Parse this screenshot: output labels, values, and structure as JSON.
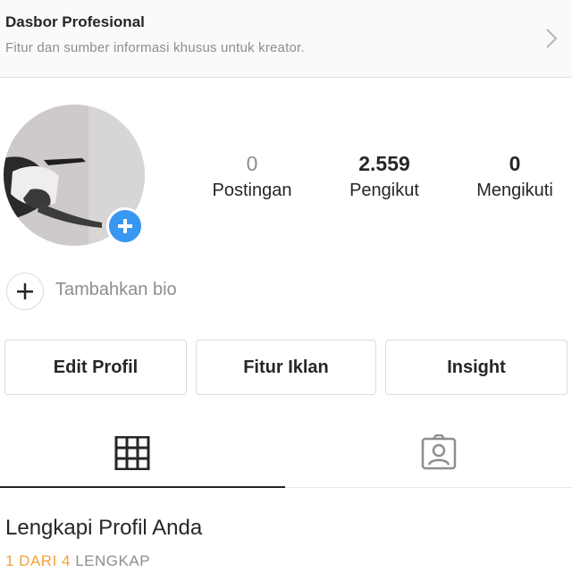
{
  "banner": {
    "title": "Dasbor Profesional",
    "subtitle": "Fitur dan sumber informasi khusus untuk kreator.",
    "chevron_icon": "chevron-right-icon"
  },
  "profile": {
    "avatar_icon": "profile-photo",
    "add_icon": "plus-icon",
    "stats": [
      {
        "value": "0",
        "label": "Postingan"
      },
      {
        "value": "2.559",
        "label": "Pengikut"
      },
      {
        "value": "0",
        "label": "Mengikuti"
      }
    ]
  },
  "bio": {
    "label": "Tambahkan bio",
    "icon": "plus-icon"
  },
  "buttons": {
    "edit": "Edit Profil",
    "ads": "Fitur Iklan",
    "insight": "Insight"
  },
  "tabs": [
    {
      "icon": "grid-icon",
      "active": true
    },
    {
      "icon": "tagged-person-icon",
      "active": false
    }
  ],
  "complete_profile": {
    "title": "Lengkapi Profil Anda",
    "progress_done": "1 DARI 4",
    "progress_rest": "LENGKAP"
  },
  "colors": {
    "accent_blue": "#3897f0",
    "progress_orange": "#f0a23c",
    "muted_text": "#8e8e8e"
  }
}
